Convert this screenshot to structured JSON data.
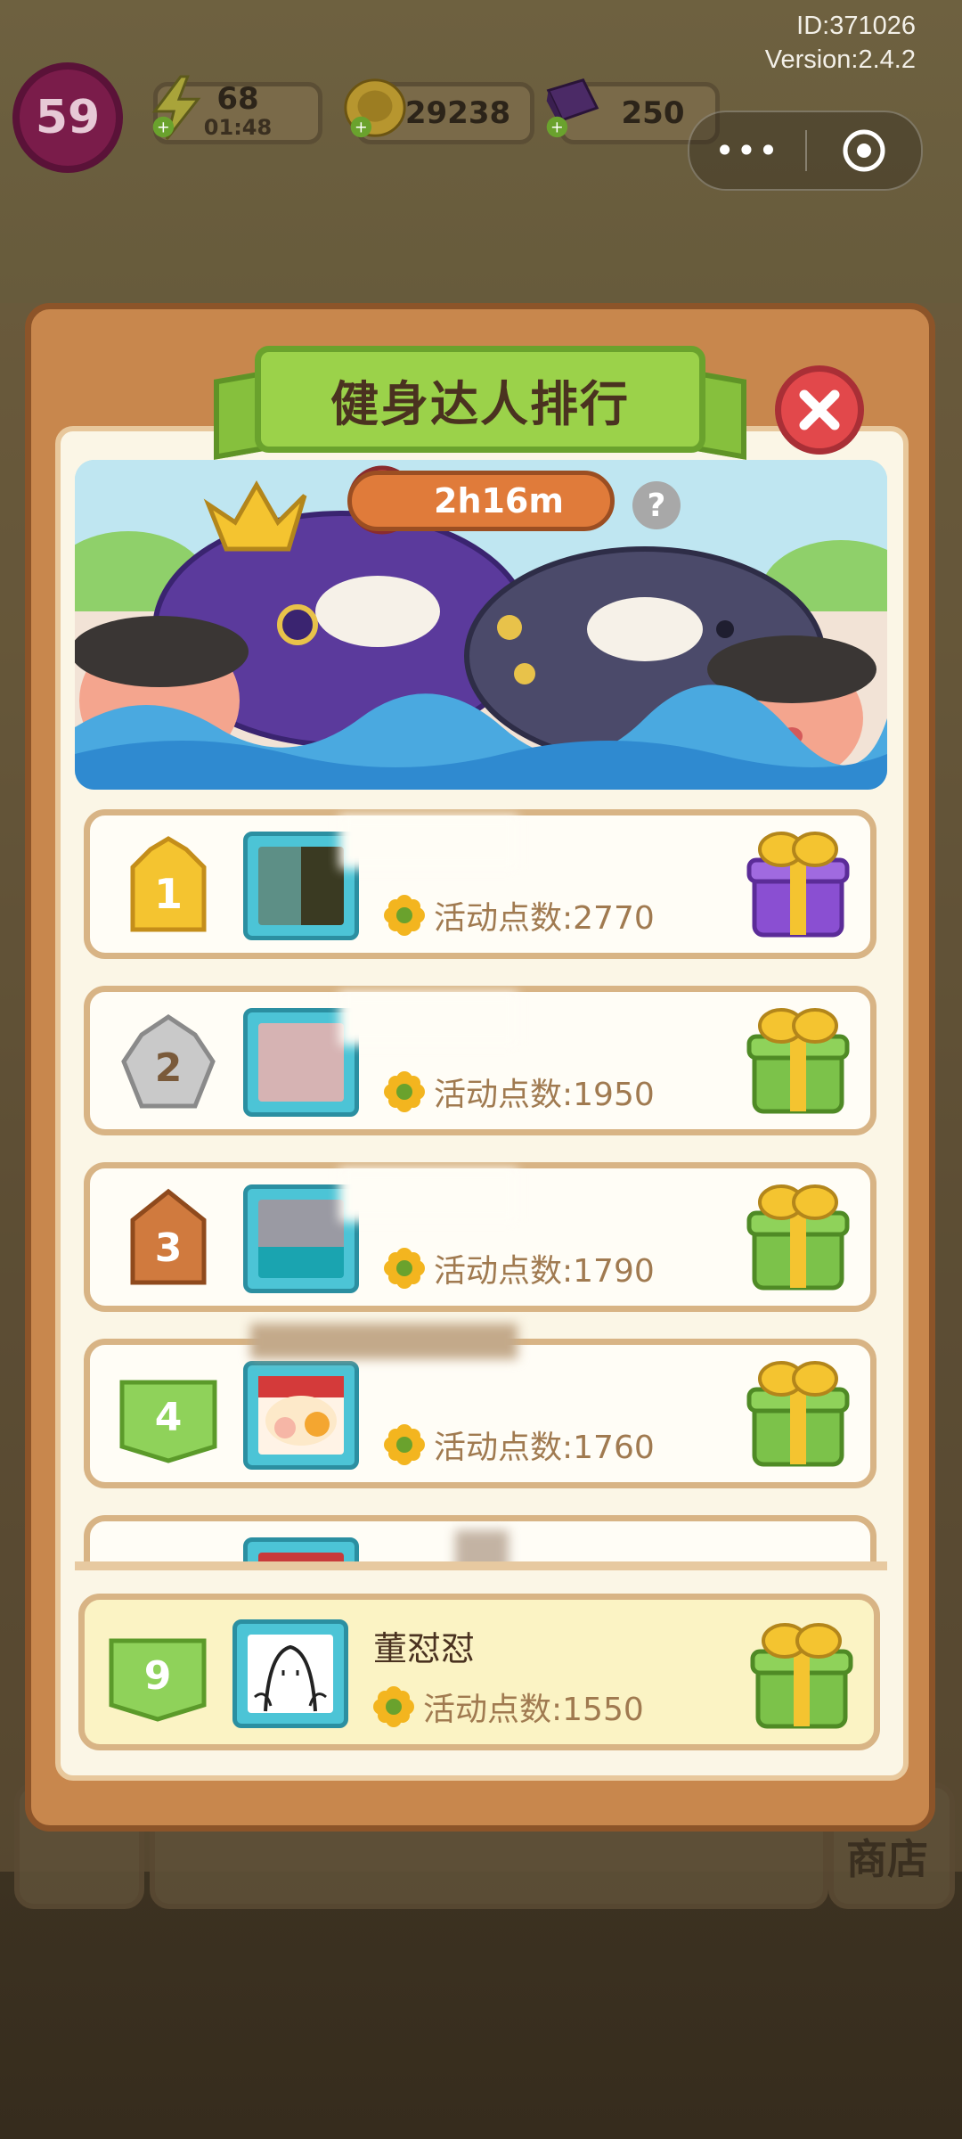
{
  "hud": {
    "id_label": "ID:371026",
    "version_label": "Version:2.4.2",
    "level": "59",
    "energy": "68",
    "energy_timer": "01:48",
    "coins": "29238",
    "gems": "250"
  },
  "modal": {
    "title": "健身达人排行",
    "timer": "2h16m",
    "help": "?"
  },
  "rankings": [
    {
      "rank": "1",
      "name": "",
      "points": "活动点数:2770",
      "gift": "purple"
    },
    {
      "rank": "2",
      "name": "",
      "points": "活动点数:1950",
      "gift": "green"
    },
    {
      "rank": "3",
      "name": "",
      "points": "活动点数:1790",
      "gift": "green"
    },
    {
      "rank": "4",
      "name": "",
      "points": "活动点数:1760",
      "gift": "green"
    }
  ],
  "self_entry": {
    "rank": "9",
    "name": "董怼怼",
    "points": "活动点数:1550"
  },
  "background": {
    "shop_label": "商店"
  },
  "colors": {
    "frame": "#c8874d",
    "ribbon": "#9bd24a",
    "close": "#e2484b",
    "avatar_border": "#4cc4d6",
    "points_text": "#a07a50"
  }
}
